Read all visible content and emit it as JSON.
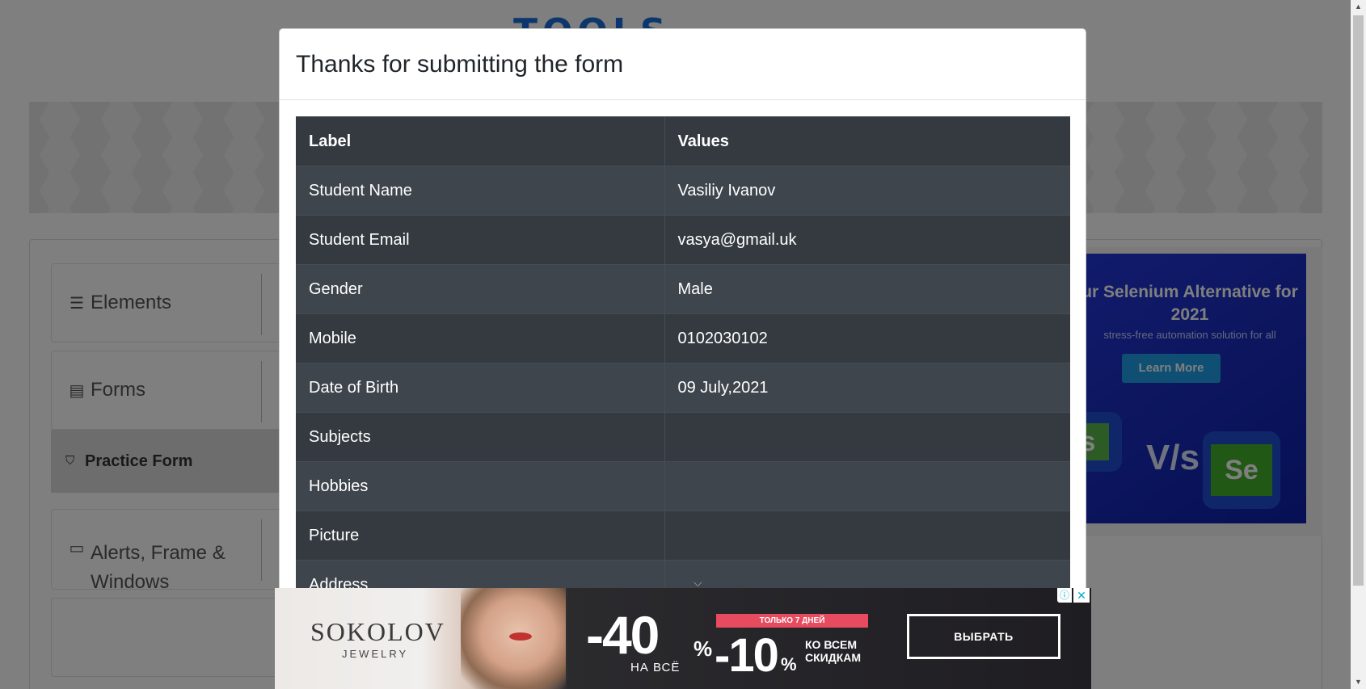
{
  "page": {
    "logo_text": "TOOLS"
  },
  "sidebar": {
    "groups": [
      {
        "label": "Elements",
        "icon": "hamburger-icon"
      },
      {
        "label": "Forms",
        "icon": "document-icon"
      },
      {
        "label": "Alerts, Frame & Windows",
        "icon": "window-icon"
      }
    ],
    "active_item": {
      "label": "Practice Form",
      "icon": "html5-icon"
    }
  },
  "right_ad": {
    "title": "ur Selenium Alternative for 2021",
    "subtitle": "stress-free automation solution for all",
    "button": "Learn More",
    "left_badge": "s",
    "vs_text": "V/s",
    "right_badge": "Se"
  },
  "modal": {
    "title": "Thanks for submitting the form",
    "table": {
      "headers": [
        "Label",
        "Values"
      ],
      "rows": [
        {
          "label": "Student Name",
          "value": "Vasiliy Ivanov"
        },
        {
          "label": "Student Email",
          "value": "vasya@gmail.uk"
        },
        {
          "label": "Gender",
          "value": "Male"
        },
        {
          "label": "Mobile",
          "value": "0102030102"
        },
        {
          "label": "Date of Birth",
          "value": "09 July,2021"
        },
        {
          "label": "Subjects",
          "value": ""
        },
        {
          "label": "Hobbies",
          "value": ""
        },
        {
          "label": "Picture",
          "value": ""
        },
        {
          "label": "Address",
          "value": ""
        }
      ]
    }
  },
  "bottom_ad": {
    "brand": "SOKOLOV",
    "brand_sub": "JEWELRY",
    "discount_main": "-40",
    "discount_main_pct": "%",
    "discount_main_sub": "НА ВСЁ",
    "promo_strip": "ТОЛЬКО 7 ДНЕЙ",
    "discount_extra": "-10",
    "discount_extra_pct": "%",
    "discount_extra_sub_1": "КО ВСЕМ",
    "discount_extra_sub_2": "СКИДКАМ",
    "cta": "ВЫБРАТЬ"
  },
  "colors": {
    "table_dark": "#343a40",
    "table_stripe": "#3f454c",
    "right_ad_bg": "#1a2dbf",
    "promo_red": "#e84a5f"
  }
}
